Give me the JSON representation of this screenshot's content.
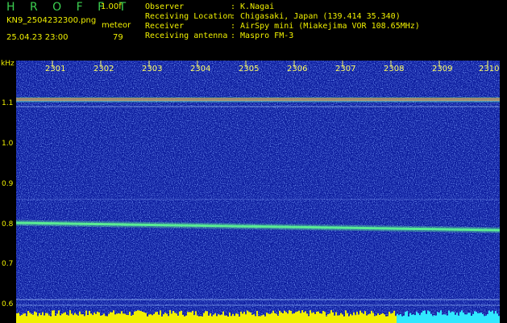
{
  "header": {
    "app_title": "H R O F F T",
    "version": "1.00f",
    "filename": "KN9_2504232300.png",
    "meteor_label": "meteor",
    "datetime": "25.04.23 23:00",
    "meteor_count": "79",
    "info": [
      {
        "key": "Observer",
        "value": ": K.Nagai"
      },
      {
        "key": "Receiving Location",
        "value": ": Chigasaki, Japan (139.414 35.340)"
      },
      {
        "key": "Receiver",
        "value": ": AirSpy mini (Miakejima VOR 108.65MHz)"
      },
      {
        "key": "Receiving antenna",
        "value": ": Maspro FM-3"
      }
    ]
  },
  "axes": {
    "y_unit": "kHz",
    "y_ticks": [
      "1.1",
      "1.0",
      "0.9",
      "0.8",
      "0.7",
      "0.6"
    ],
    "x_ticks": [
      "2301",
      "2302",
      "2303",
      "2304",
      "2305",
      "2306",
      "2307",
      "2308",
      "2309",
      "2310"
    ]
  },
  "colors": {
    "background_noise": "#0a1a9c",
    "signal": "#60ff90",
    "label": "#f0f000",
    "power_bar": "#f0f000",
    "power_bar_tail": "#30e8ff"
  }
}
